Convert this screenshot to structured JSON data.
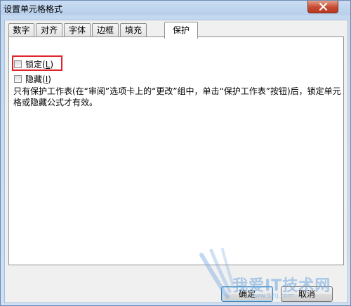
{
  "window": {
    "title": "设置单元格格式",
    "close_icon": "close-icon"
  },
  "tabs": [
    {
      "label": "数字"
    },
    {
      "label": "对齐"
    },
    {
      "label": "字体"
    },
    {
      "label": "边框"
    },
    {
      "label": "填充"
    },
    {
      "label": "保护",
      "active": true
    }
  ],
  "protection": {
    "locked_label_text": "锁定(",
    "locked_label_key": "L",
    "locked_label_end": ")",
    "locked_checked": false,
    "hidden_label_text": "隐藏(",
    "hidden_label_key": "I",
    "hidden_label_end": ")",
    "hidden_checked": false,
    "description": "只有保护工作表(在“审阅”选项卡上的“更改”组中，单击“保护工作表”按钮)后，锁定单元格或隐藏公式才有效。"
  },
  "buttons": {
    "ok_label": "确定",
    "cancel_label": "取消"
  },
  "watermark": {
    "text": "我爱IT技术网",
    "url": "www.52ij.com"
  },
  "colors": {
    "highlight": "#e0242b",
    "close_button": "#c44a31",
    "title_bar": "#b7cfec"
  }
}
